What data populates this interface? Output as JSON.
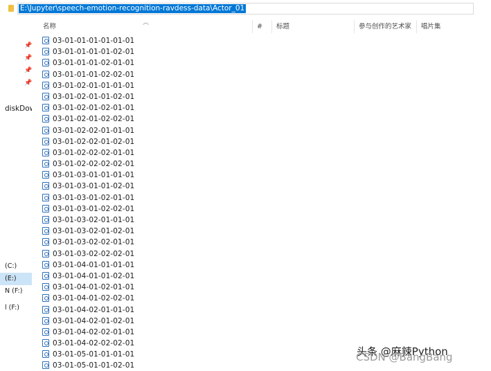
{
  "address": {
    "path": "E:\\Jupyter\\speech-emotion-recognition-ravdess-data\\Actor_01"
  },
  "columns": {
    "name": "名称",
    "number": "#",
    "title": "标题",
    "contributing_artists": "参与创作的艺术家",
    "album": "唱片集"
  },
  "nav": {
    "pins": [
      "pin-icon",
      "pin-icon",
      "pin-icon",
      "pin-icon"
    ],
    "diskdow": "diskDow",
    "drives": [
      {
        "label": "(C:)",
        "selected": false
      },
      {
        "label": "(E:)",
        "selected": true
      },
      {
        "label": "N (F:)",
        "selected": false
      },
      {
        "label": "l (F:)",
        "selected": false
      }
    ]
  },
  "files": [
    "03-01-01-01-01-01-01",
    "03-01-01-01-01-02-01",
    "03-01-01-01-02-01-01",
    "03-01-01-01-02-02-01",
    "03-01-02-01-01-01-01",
    "03-01-02-01-01-02-01",
    "03-01-02-01-02-01-01",
    "03-01-02-01-02-02-01",
    "03-01-02-02-01-01-01",
    "03-01-02-02-01-02-01",
    "03-01-02-02-02-01-01",
    "03-01-02-02-02-02-01",
    "03-01-03-01-01-01-01",
    "03-01-03-01-01-02-01",
    "03-01-03-01-02-01-01",
    "03-01-03-01-02-02-01",
    "03-01-03-02-01-01-01",
    "03-01-03-02-01-02-01",
    "03-01-03-02-02-01-01",
    "03-01-03-02-02-02-01",
    "03-01-04-01-01-01-01",
    "03-01-04-01-01-02-01",
    "03-01-04-01-02-01-01",
    "03-01-04-01-02-02-01",
    "03-01-04-02-01-01-01",
    "03-01-04-02-01-02-01",
    "03-01-04-02-02-01-01",
    "03-01-04-02-02-02-01",
    "03-01-05-01-01-01-01",
    "03-01-05-01-01-02-01"
  ],
  "watermark": {
    "line1": "头条 @麻辣Python",
    "line2": "CSDN @BangBang"
  },
  "colors": {
    "selection": "#0078d7",
    "nav_selected": "#cce4f7"
  }
}
